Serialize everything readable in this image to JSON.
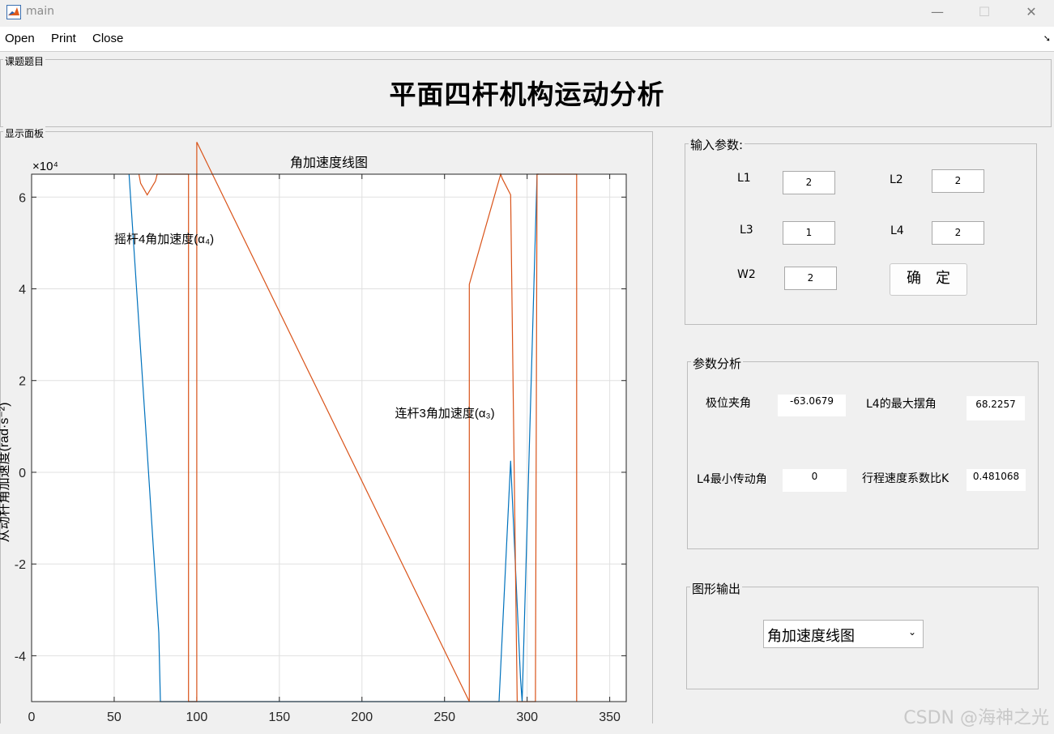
{
  "window": {
    "title": "main",
    "minimize": "—",
    "maximize": "☐",
    "close": "✕",
    "icon": "matlab-icon"
  },
  "menu": [
    "Open",
    "Print",
    "Close"
  ],
  "topic_panel": {
    "label": "课题题目",
    "title": "平面四杆机构运动分析"
  },
  "display_panel": {
    "label": "显示面板"
  },
  "input_panel": {
    "label": "输入参数:",
    "fields": [
      {
        "label": "L1",
        "value": "2"
      },
      {
        "label": "L2",
        "value": "2"
      },
      {
        "label": "L3",
        "value": "1"
      },
      {
        "label": "L4",
        "value": "2"
      },
      {
        "label": "W2",
        "value": "2"
      }
    ],
    "confirm_label": "确　定"
  },
  "analysis_panel": {
    "label": "参数分析",
    "items": [
      {
        "label": "极位夹角",
        "value": "-63.0679"
      },
      {
        "label": "L4的最大摆角",
        "value": "68.2257"
      },
      {
        "label": "L4最小传动角",
        "value": "0"
      },
      {
        "label": "行程速度系数比K",
        "value": "0.481068"
      }
    ]
  },
  "output_panel": {
    "label": "图形输出",
    "selected": "角加速度线图"
  },
  "watermark": "CSDN @海神之光",
  "chart_data": {
    "type": "line",
    "title": "角加速度线图",
    "ylabel": "从动杆角加速度(rad·s⁻²)",
    "xlabel": "",
    "xlim": [
      0,
      360
    ],
    "ylim": [
      -50000,
      65000
    ],
    "xticks": [
      0,
      50,
      100,
      150,
      200,
      250,
      300,
      350
    ],
    "yticks": [
      -40000,
      -20000,
      0,
      20000,
      40000,
      60000
    ],
    "ytick_labels": [
      "-4",
      "-2",
      "0",
      "2",
      "4",
      "6"
    ],
    "y_exponent": "×10⁴",
    "grid": true,
    "colors": {
      "alpha4": "#0072bd",
      "alpha3": "#d95319"
    },
    "annotations": [
      {
        "text": "摇杆4角加速度(α₄)",
        "x": 50,
        "y": 50000
      },
      {
        "text": "连杆3角加速度(α₃)",
        "x": 220,
        "y": 12000
      }
    ],
    "series": [
      {
        "key": "alpha4",
        "x": [
          59,
          69,
          77,
          78,
          283,
          290,
          296,
          297,
          306,
          307
        ],
        "y": [
          65000,
          10000,
          -35000,
          -50000,
          -50000,
          2500,
          -45000,
          -50000,
          65000,
          65000
        ]
      },
      {
        "key": "alpha3",
        "x": [
          65,
          66,
          70,
          75,
          76,
          95,
          95,
          100,
          100,
          265,
          265,
          284,
          285,
          290,
          294,
          305,
          306,
          330,
          330
        ],
        "y": [
          65000,
          63000,
          60500,
          63500,
          65000,
          65000,
          -50000,
          -50000,
          72000,
          -50000,
          41000,
          65000,
          64000,
          60500,
          -50000,
          -50000,
          65000,
          65000,
          -50000
        ]
      }
    ]
  }
}
